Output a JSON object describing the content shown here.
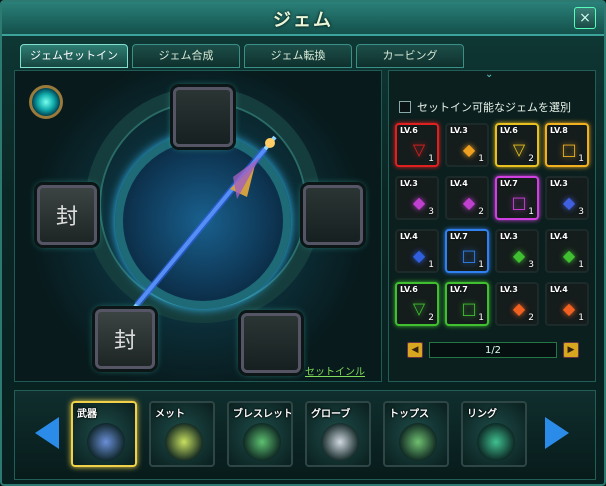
{
  "window": {
    "title": "ジェム",
    "close_label": "×"
  },
  "tabs": [
    {
      "label": "ジェムセットイン"
    },
    {
      "label": "ジェム合成"
    },
    {
      "label": "ジェム転換"
    },
    {
      "label": "カービング"
    }
  ],
  "socket": {
    "sealed_label": "封",
    "set_link": "セットインル"
  },
  "gem_panel": {
    "filter_label": "セットイン可能なジェムを選別",
    "gems": [
      {
        "level": "LV.6",
        "count": "1",
        "color": "#e02020",
        "shape": "▽"
      },
      {
        "level": "LV.3",
        "count": "1",
        "color": "#f0a020",
        "shape": "◆"
      },
      {
        "level": "LV.6",
        "count": "2",
        "color": "#e8c020",
        "shape": "▽"
      },
      {
        "level": "LV.8",
        "count": "1",
        "color": "#f0b020",
        "shape": "□"
      },
      {
        "level": "LV.3",
        "count": "3",
        "color": "#c040d0",
        "shape": "◆"
      },
      {
        "level": "LV.4",
        "count": "2",
        "color": "#c040d0",
        "shape": "◆"
      },
      {
        "level": "LV.7",
        "count": "1",
        "color": "#d040e0",
        "shape": "□"
      },
      {
        "level": "LV.3",
        "count": "3",
        "color": "#4060e0",
        "shape": "◆"
      },
      {
        "level": "LV.4",
        "count": "1",
        "color": "#3060e0",
        "shape": "◆"
      },
      {
        "level": "LV.7",
        "count": "1",
        "color": "#3080f0",
        "shape": "□"
      },
      {
        "level": "LV.3",
        "count": "3",
        "color": "#40c030",
        "shape": "◆"
      },
      {
        "level": "LV.4",
        "count": "1",
        "color": "#40c030",
        "shape": "◆"
      },
      {
        "level": "LV.6",
        "count": "2",
        "color": "#40c030",
        "shape": "▽"
      },
      {
        "level": "LV.7",
        "count": "1",
        "color": "#40c030",
        "shape": "□"
      },
      {
        "level": "LV.3",
        "count": "2",
        "color": "#f06020",
        "shape": "◆"
      },
      {
        "level": "LV.4",
        "count": "1",
        "color": "#f06020",
        "shape": "◆"
      }
    ],
    "page": "1/2",
    "prev_label": "◀",
    "next_label": "▶"
  },
  "equipment": {
    "items": [
      {
        "label": "武器"
      },
      {
        "label": "メット"
      },
      {
        "label": "ブレスレット"
      },
      {
        "label": "グローブ"
      },
      {
        "label": "トップス"
      },
      {
        "label": "リング"
      }
    ]
  },
  "colors": {
    "accent": "#3ba399",
    "selected": "#f1d14a",
    "nav_arrow": "#2a8ce8"
  }
}
